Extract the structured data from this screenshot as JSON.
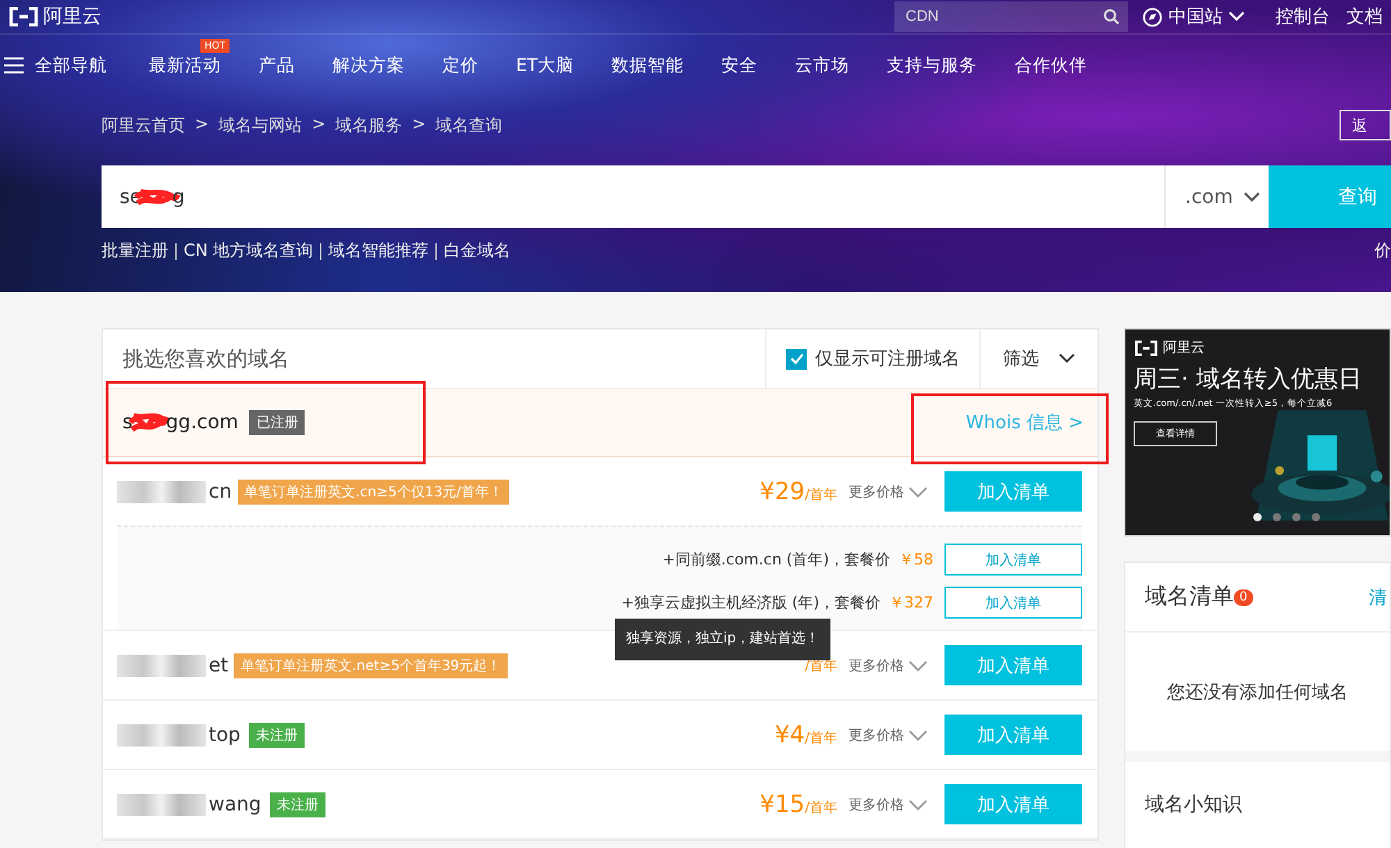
{
  "topbar": {
    "logo": "阿里云",
    "search": {
      "placeholder": "CDN"
    },
    "region": "中国站",
    "links": [
      "控制台",
      "文档"
    ]
  },
  "nav": {
    "all": "全部导航",
    "items": [
      {
        "label": "最新活动",
        "badge": "HOT"
      },
      {
        "label": "产品"
      },
      {
        "label": "解决方案"
      },
      {
        "label": "定价"
      },
      {
        "label": "ET大脑"
      },
      {
        "label": "数据智能"
      },
      {
        "label": "安全"
      },
      {
        "label": "云市场"
      },
      {
        "label": "支持与服务"
      },
      {
        "label": "合作伙伴"
      }
    ]
  },
  "breadcrumb": [
    {
      "label": "阿里云首页"
    },
    {
      "separator": ">",
      "label": "域名与网站"
    },
    {
      "separator": ">",
      "label": "域名服务"
    },
    {
      "separator": ">",
      "label": "域名查询"
    }
  ],
  "back_button": "返",
  "search": {
    "value_start": "se",
    "value_end": "g",
    "suffix": ".com",
    "button": "查询"
  },
  "quick_links": [
    "批量注册",
    "CN 地方域名查询",
    "域名智能推荐",
    "白金域名"
  ],
  "price_link": "价",
  "results": {
    "title": "挑选您喜欢的域名",
    "only_available": {
      "label": "仅显示可注册域名",
      "checked": true
    },
    "filter": "筛选",
    "registered": {
      "name_start": "s",
      "name_end": "gg.com",
      "status": "已注册",
      "whois": "Whois 信息 >"
    },
    "rows": [
      {
        "suffix": "cn",
        "promo": "单笔订单注册英文.cn≥5个仅13元/首年！",
        "kind": "promo",
        "price": "¥29",
        "unit": "/首年",
        "more": "更多价格",
        "button": "加入清单",
        "bundles": [
          {
            "text": "+同前缀.com.cn (首年)，套餐价",
            "price": "￥58",
            "button": "加入清单"
          },
          {
            "text": "+独享云虚拟主机经济版 (年)，套餐价",
            "price": "￥327",
            "button": "加入清单"
          }
        ]
      },
      {
        "suffix": "et",
        "promo": "单笔订单注册英文.net≥5个首年39元起！",
        "kind": "promo",
        "unit": "/首年",
        "more": "更多价格",
        "button": "加入清单"
      },
      {
        "suffix": "top",
        "promo": "未注册",
        "kind": "free",
        "price": "¥4",
        "unit": "/首年",
        "more": "更多价格",
        "button": "加入清单"
      },
      {
        "suffix": "wang",
        "promo": "未注册",
        "kind": "free",
        "price": "¥15",
        "unit": "/首年",
        "more": "更多价格",
        "button": "加入清单"
      }
    ],
    "tooltip": "独享资源，独立ip，建站首选！"
  },
  "ad": {
    "logo": "阿里云",
    "title": "周三· 域名转入优惠日",
    "subtitle": "英文.com/.cn/.net  一次性转入≥5，每个立减6",
    "button": "查看详情",
    "dots": [
      {
        "selected": true
      },
      {
        "selected": false
      },
      {
        "selected": false
      },
      {
        "selected": false
      }
    ]
  },
  "cart": {
    "title": "域名清单",
    "count": "0",
    "clear": "清",
    "empty": "您还没有添加任何域名",
    "tips_title": "域名小知识"
  }
}
